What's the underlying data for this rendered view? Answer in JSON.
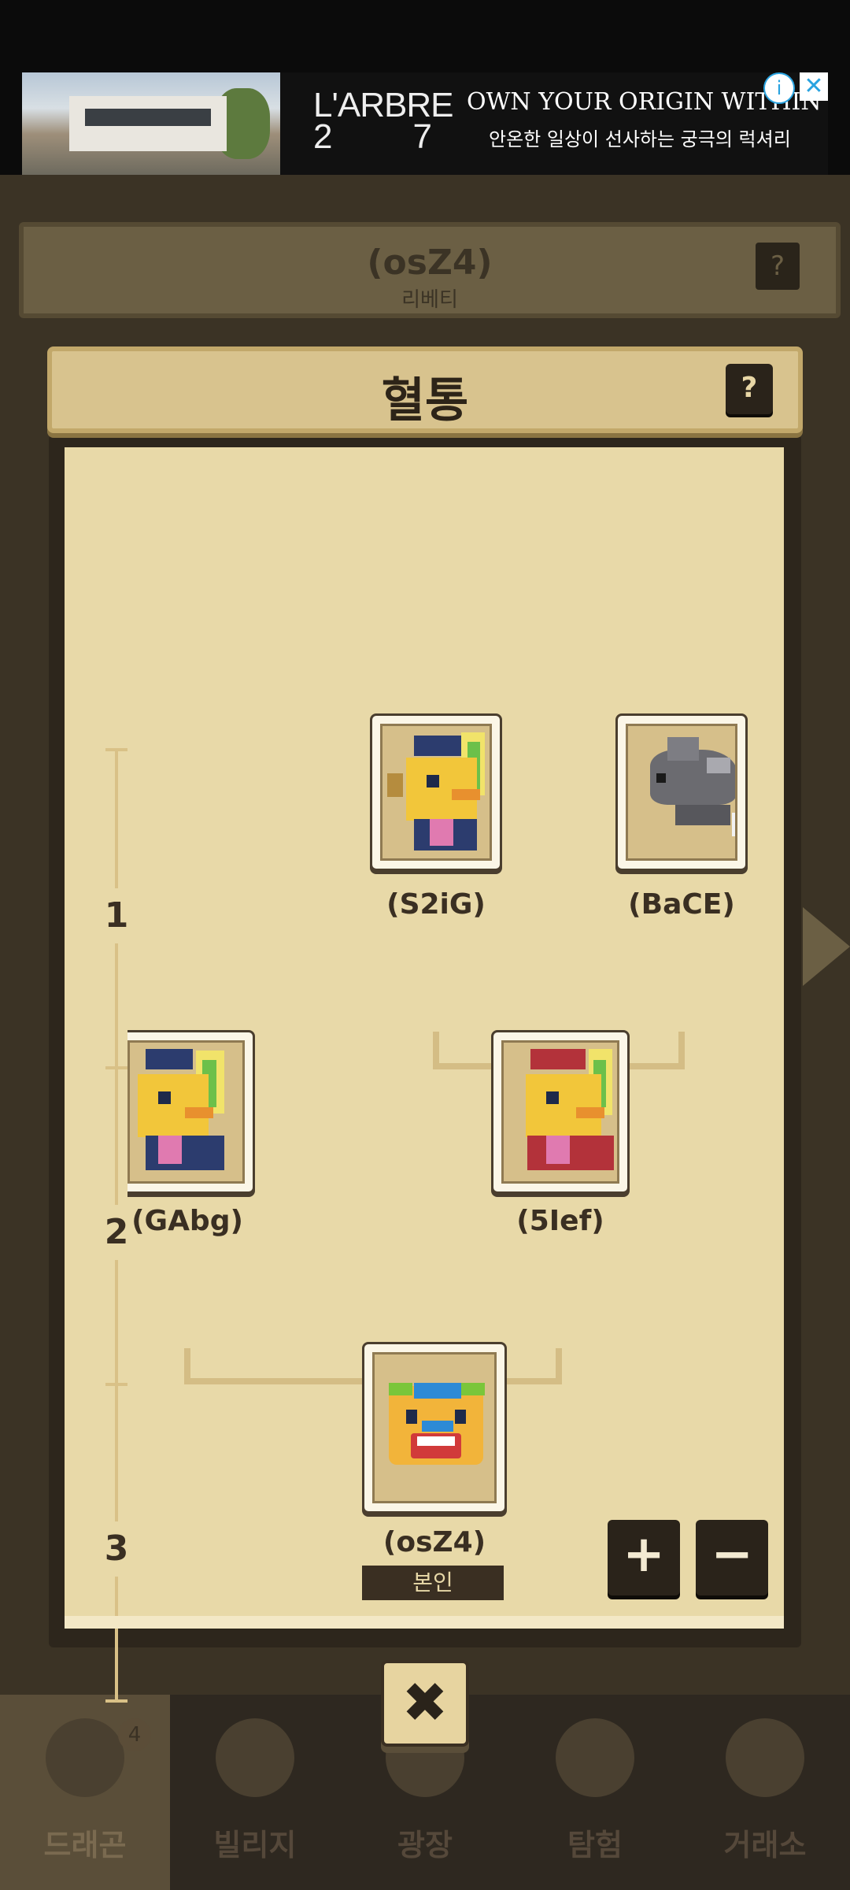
{
  "ad": {
    "brand_top": "L'ARBRE",
    "brand_num_left": "2",
    "brand_num_right": "7",
    "headline": "OWN YOUR ORIGIN WITHIN",
    "subline": "안온한 일상이 선사하는 궁극의 럭셔리",
    "info_icon": "i",
    "close_icon": "✕"
  },
  "background": {
    "dragon_name": "(osZ4)",
    "dragon_subtitle": "리베티",
    "help_label": "?",
    "nav": [
      {
        "label": "드래곤",
        "icon": "dragon-icon",
        "badge": "4"
      },
      {
        "label": "빌리지",
        "icon": "village-icon"
      },
      {
        "label": "광장",
        "icon": "plaza-icon"
      },
      {
        "label": "탐험",
        "icon": "compass-icon"
      },
      {
        "label": "거래소",
        "icon": "exchange-icon"
      }
    ]
  },
  "modal": {
    "title": "혈통",
    "help_label": "?",
    "generations": [
      "1",
      "2",
      "3"
    ],
    "ancestors": {
      "gen1_left": "(S2iG)",
      "gen1_right": "(BaCE)",
      "gen2_left": "(GAbg)",
      "gen2_right": "(5Ief)",
      "self": "(osZ4)"
    },
    "self_badge": "본인",
    "zoom_in": "+",
    "zoom_out": "−",
    "close": "✖"
  },
  "colors": {
    "panel": "#e8d9a8",
    "frame": "#2d261c",
    "accent": "#d8c38e"
  }
}
